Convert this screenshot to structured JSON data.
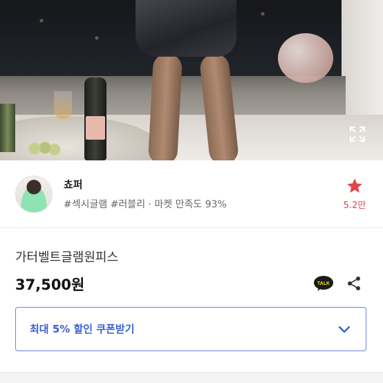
{
  "hero": {
    "expand_icon": "expand-icon"
  },
  "seller": {
    "name": "쵸퍼",
    "description": "#섹시글램 #러블리 · 마켓 만족도 93%",
    "favorite_count": "5.2만",
    "favorite_icon": "star-icon"
  },
  "product": {
    "title": "가터벨트글램원피스",
    "price": "37,500원",
    "talk_icon": "talk-icon",
    "share_icon": "share-icon"
  },
  "coupon": {
    "label": "최대 5% 할인 쿠폰받기",
    "chevron_icon": "chevron-down-icon"
  },
  "colors": {
    "star": "#e0464c",
    "coupon_border": "#6a86e0",
    "coupon_text": "#3a5fd0",
    "talk_yellow": "#f7e600"
  }
}
